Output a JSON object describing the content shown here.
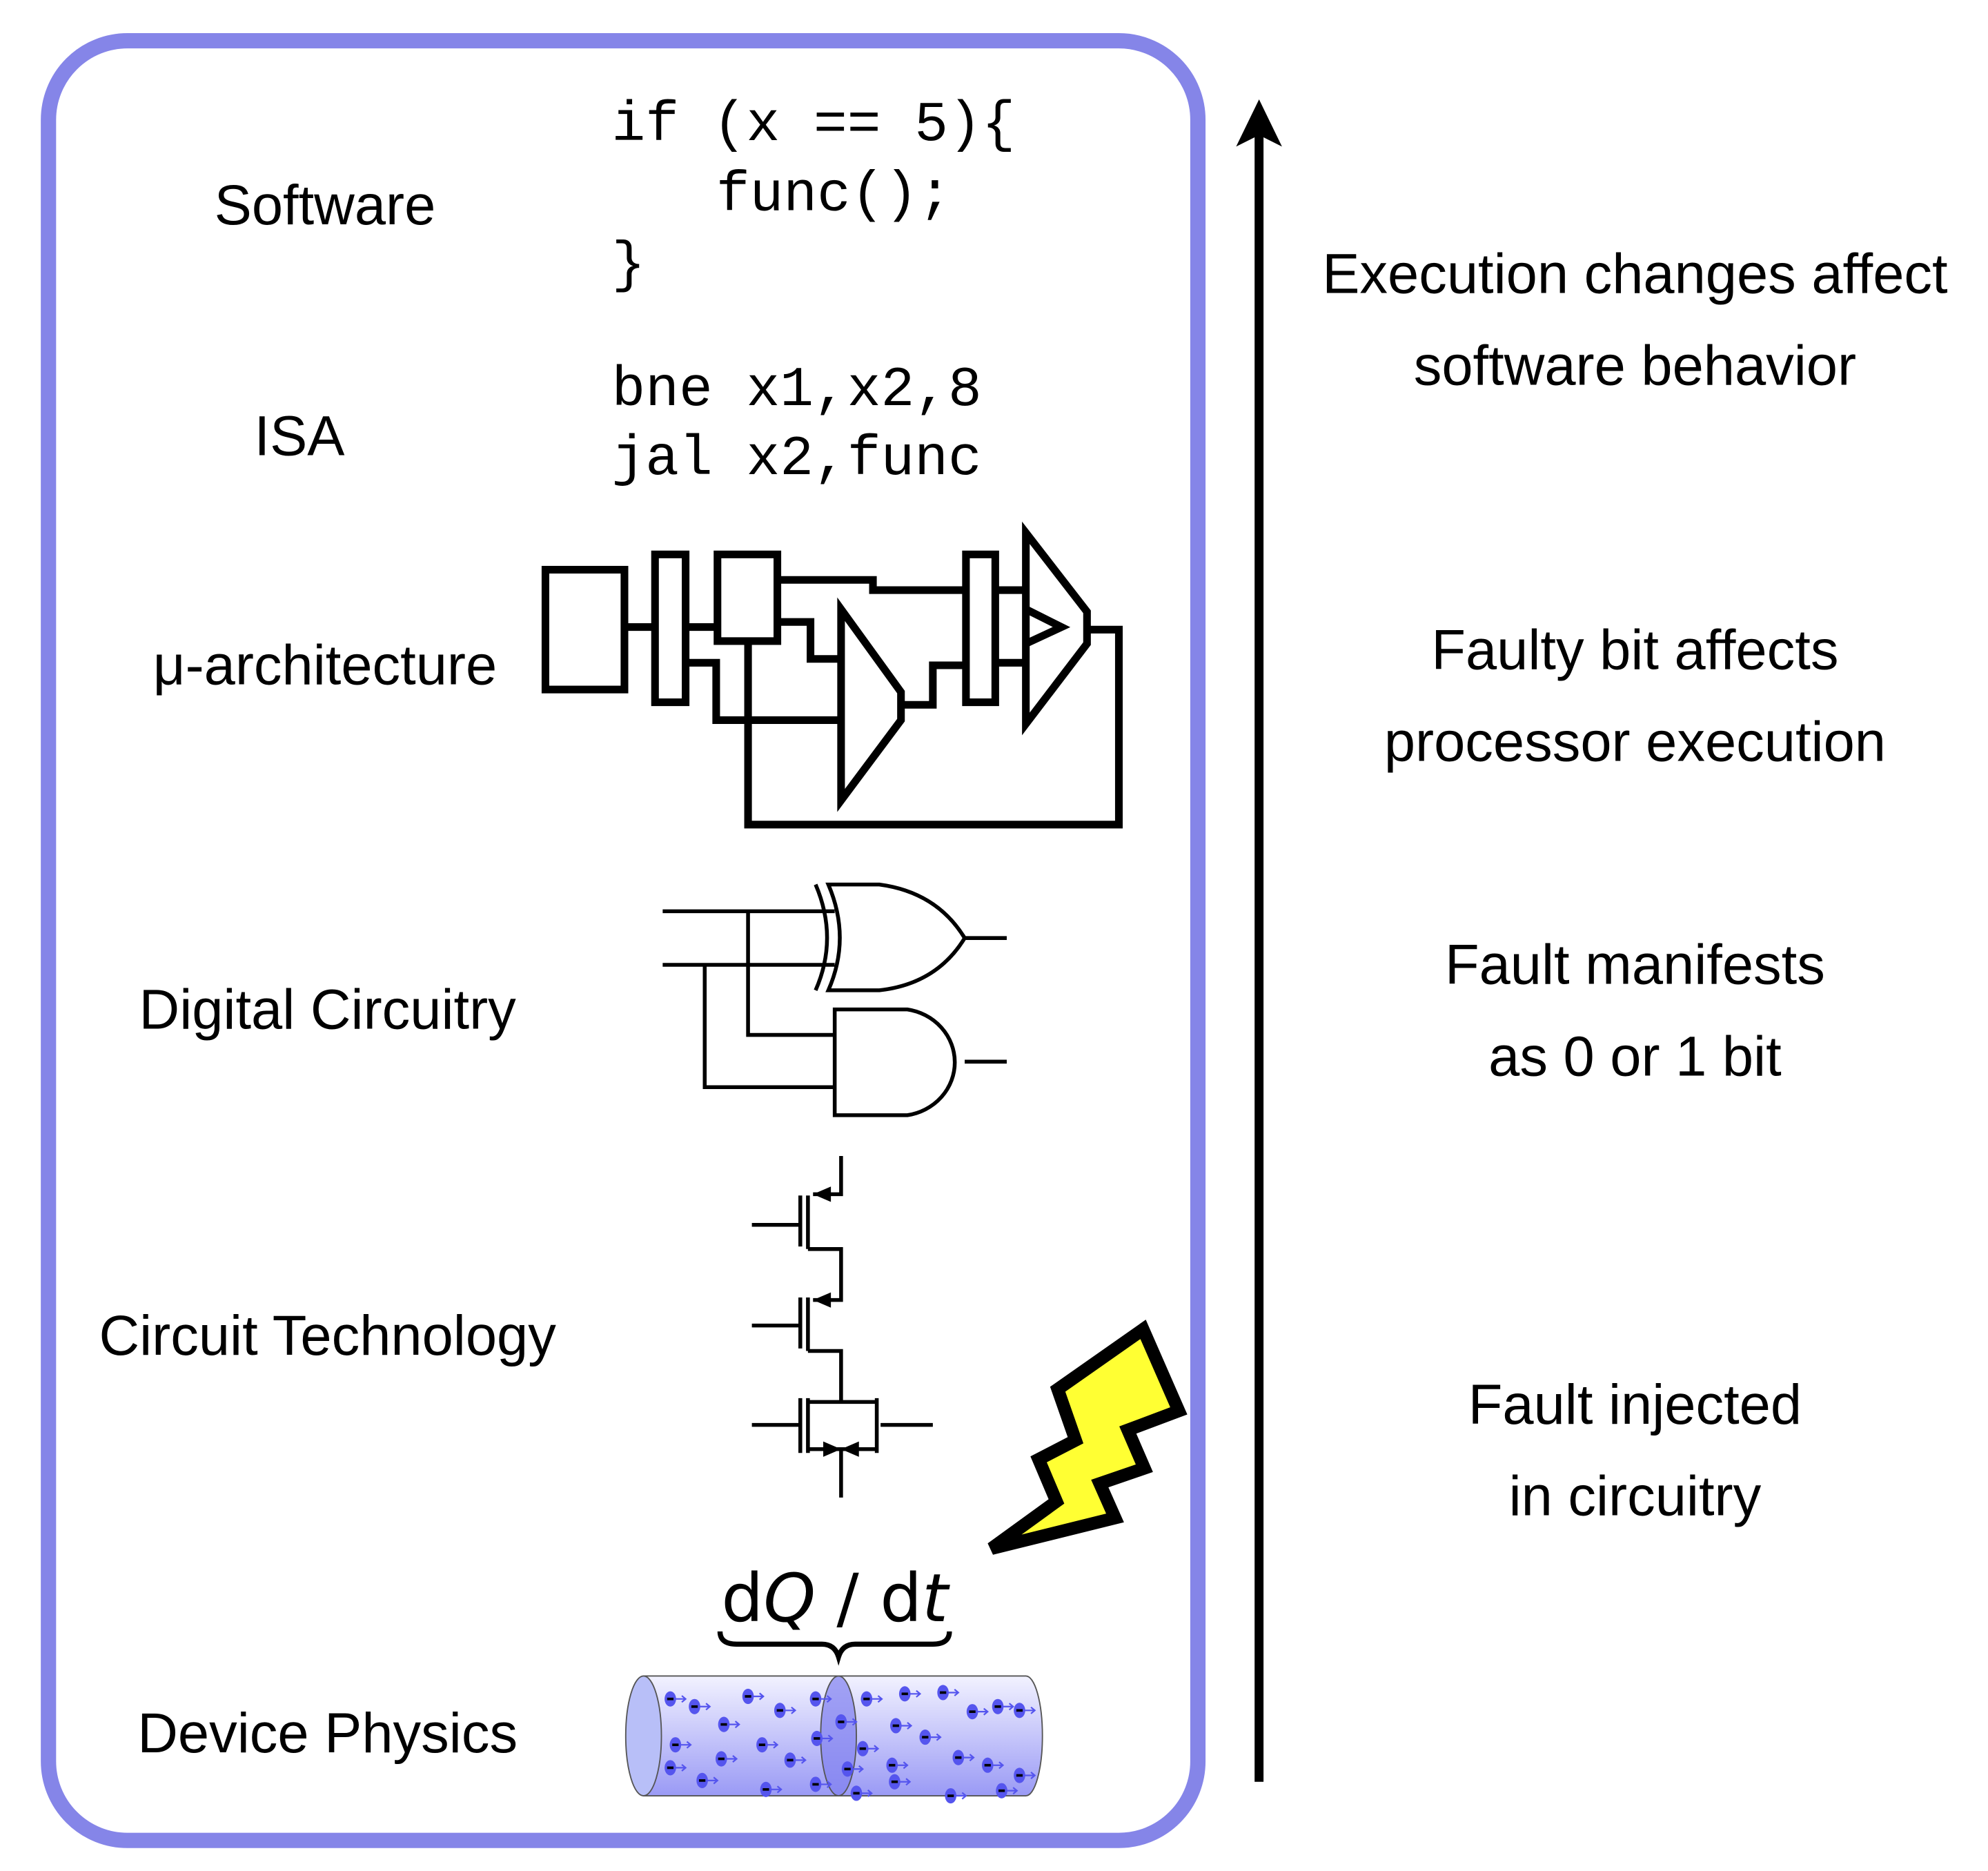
{
  "layers": [
    {
      "label": "Software"
    },
    {
      "label": "ISA"
    },
    {
      "label": "μ-architecture"
    },
    {
      "label": "Digital Circuitry"
    },
    {
      "label": "Circuit Technology"
    },
    {
      "label": "Device Physics"
    }
  ],
  "software_code": [
    "if (x == 5){",
    "func();",
    "}"
  ],
  "isa_code": [
    "bne x1,x2,8",
    "jal x2,func"
  ],
  "equation": {
    "d1": "d",
    "q": "Q",
    "slash": " / ",
    "d2": "d",
    "t": "t"
  },
  "descriptions": [
    {
      "line1": "Execution changes affect",
      "line2": "software behavior"
    },
    {
      "line1": "Faulty bit affects",
      "line2": "processor execution"
    },
    {
      "line1": "Fault manifests",
      "line2": "as 0 or 1 bit"
    },
    {
      "line1": "Fault injected",
      "line2": "in circuitry"
    }
  ],
  "colors": {
    "frame": "#8585e8",
    "bolt_fill": "#ffff33",
    "wire_gradient_top": "#f2f2ff",
    "wire_gradient_bottom": "#9a9af5",
    "electron": "#5555ee"
  },
  "icons": {
    "bolt": "lightning-bolt-icon",
    "arrow": "arrow-up-icon"
  }
}
